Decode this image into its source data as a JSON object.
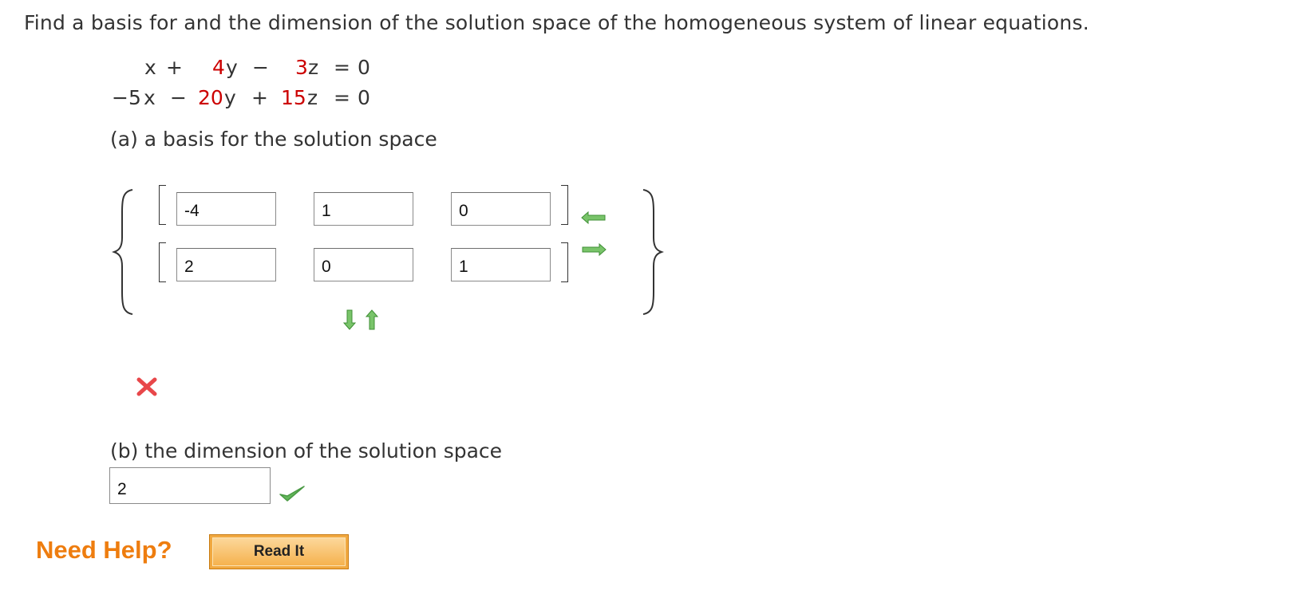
{
  "question": "Find a basis for and the dimension of the solution space of the homogeneous system of linear equations.",
  "equations": [
    {
      "c1": "",
      "v1": "x",
      "op1": "+",
      "c2": "4",
      "v2": "y",
      "op2": "−",
      "c3": "3",
      "v3": "z",
      "eq": "=",
      "rhs": "0"
    },
    {
      "c1": "−5",
      "v1": "x",
      "op1": "−",
      "c2": "20",
      "v2": "y",
      "op2": "+",
      "c3": "15",
      "v3": "z",
      "eq": "=",
      "rhs": "0"
    }
  ],
  "part_a": {
    "label": "(a) a basis for the solution space",
    "vectors": [
      [
        "-4",
        "1",
        "0"
      ],
      [
        "2",
        "0",
        "1"
      ]
    ],
    "status": "incorrect",
    "status_color": "#e8474a"
  },
  "part_b": {
    "label": "(b) the dimension of the solution space",
    "value": "2",
    "status": "correct",
    "status_color": "#5cb85c"
  },
  "help": {
    "label": "Need Help?",
    "button": "Read It"
  },
  "colors": {
    "text": "#333333",
    "coefficient_red": "#cc0000",
    "arrow_green": "#6cbf5a",
    "help_orange": "#ee7d0f"
  },
  "icons": [
    "left-arrow-icon",
    "right-arrow-icon",
    "down-arrow-icon",
    "up-arrow-icon",
    "cross-icon",
    "checkmark-icon"
  ]
}
